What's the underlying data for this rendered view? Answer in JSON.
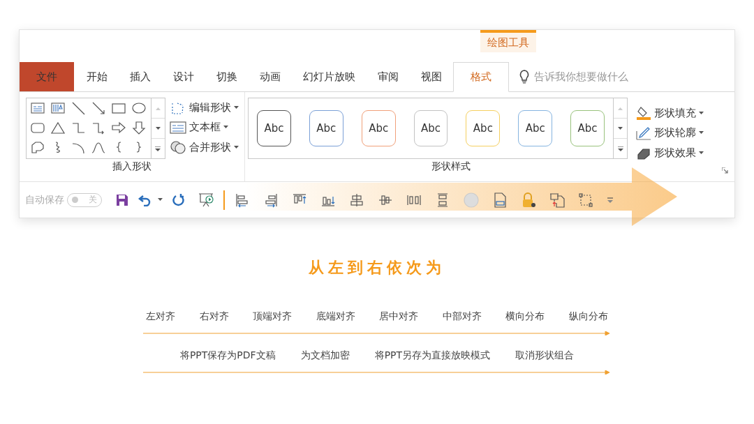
{
  "context_tab": {
    "label": "绘图工具"
  },
  "tabs": [
    {
      "label": "文件",
      "kind": "file",
      "selected": false
    },
    {
      "label": "开始",
      "kind": "tab",
      "selected": false
    },
    {
      "label": "插入",
      "kind": "tab",
      "selected": false
    },
    {
      "label": "设计",
      "kind": "tab",
      "selected": false
    },
    {
      "label": "切换",
      "kind": "tab",
      "selected": false
    },
    {
      "label": "动画",
      "kind": "tab",
      "selected": false
    },
    {
      "label": "幻灯片放映",
      "kind": "tab",
      "selected": false
    },
    {
      "label": "审阅",
      "kind": "tab",
      "selected": false
    },
    {
      "label": "视图",
      "kind": "tab",
      "selected": false
    },
    {
      "label": "格式",
      "kind": "tab",
      "selected": true
    }
  ],
  "tell_me": {
    "placeholder": "告诉我你想要做什么"
  },
  "insert_shapes": {
    "commands": [
      {
        "label": "编辑形状",
        "kind": "edit"
      },
      {
        "label": "文本框",
        "kind": "textbox"
      },
      {
        "label": "合并形状",
        "kind": "merge"
      }
    ],
    "group_label": "插入形状"
  },
  "shape_styles": {
    "styles": [
      {
        "label": "Abc",
        "color": "#555555"
      },
      {
        "label": "Abc",
        "color": "#7a9fd6"
      },
      {
        "label": "Abc",
        "color": "#f0a07a"
      },
      {
        "label": "Abc",
        "color": "#c2c2c2"
      },
      {
        "label": "Abc",
        "color": "#f5d060"
      },
      {
        "label": "Abc",
        "color": "#86b4e0"
      },
      {
        "label": "Abc",
        "color": "#98c27c"
      }
    ],
    "commands": [
      {
        "label": "形状填充",
        "kind": "fill"
      },
      {
        "label": "形状轮廓",
        "kind": "outline"
      },
      {
        "label": "形状效果",
        "kind": "effect"
      }
    ],
    "group_label": "形状样式"
  },
  "quick_access": {
    "autosave_label": "自动保存",
    "autosave": {
      "on": false,
      "label": "关"
    }
  },
  "caption": {
    "title": "从左到右依次为",
    "lines": [
      {
        "items": [
          "左对齐",
          "右对齐",
          "顶端对齐",
          "底端对齐",
          "居中对齐",
          "中部对齐",
          "横向分布",
          "纵向分布"
        ]
      },
      {
        "items": [
          "将PPT保存为PDF文稿",
          "为文档加密",
          "将PPT另存为直接放映模式",
          "取消形状组合"
        ]
      }
    ]
  }
}
